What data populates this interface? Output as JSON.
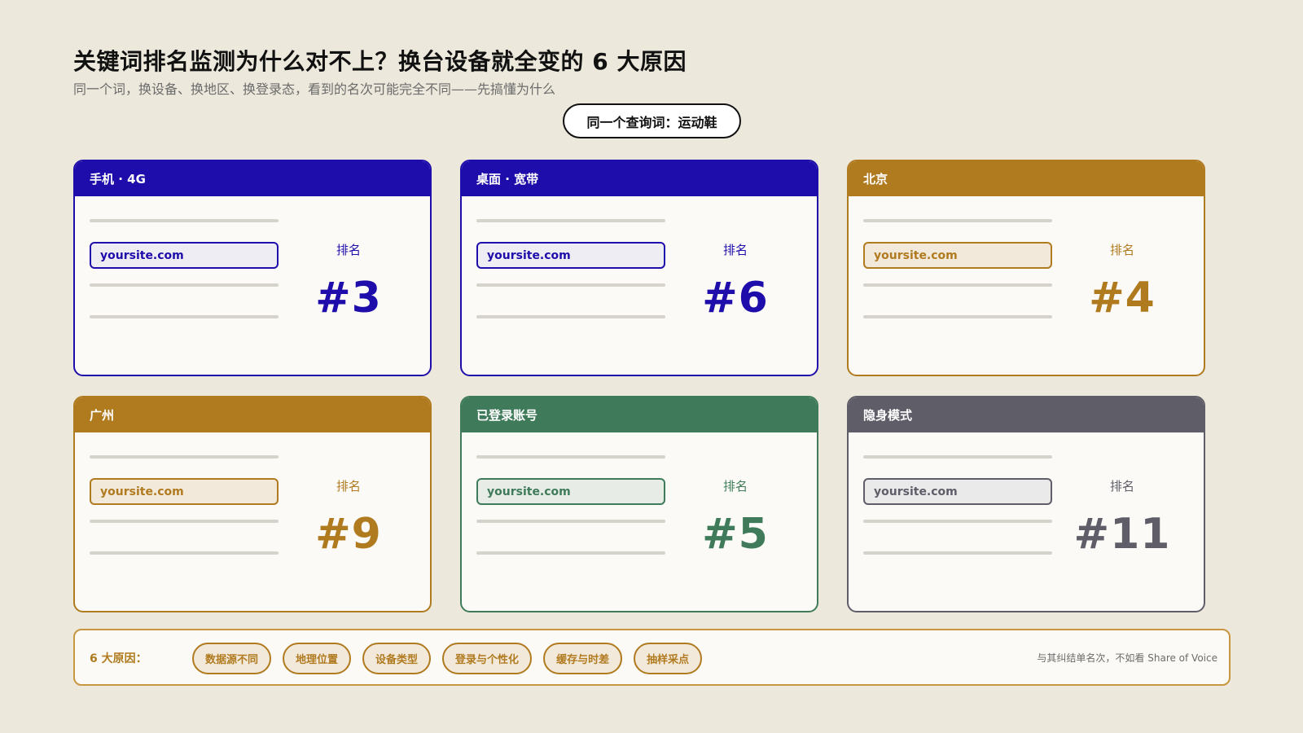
{
  "header": {
    "title": "关键词排名监测为什么对不上？换台设备就全变的 6 大原因",
    "subtitle": "同一个词，换设备、换地区、换登录态，看到的名次可能完全不同——先搞懂为什么",
    "query": "同一个查询词：运动鞋"
  },
  "cards": [
    {
      "label": "手机 · 4G",
      "site": "yoursite.com",
      "rank_label": "排名",
      "rank": "#3",
      "color": "#1E0DAA"
    },
    {
      "label": "桌面 · 宽带",
      "site": "yoursite.com",
      "rank_label": "排名",
      "rank": "#6",
      "color": "#1E0DAA"
    },
    {
      "label": "北京",
      "site": "yoursite.com",
      "rank_label": "排名",
      "rank": "#4",
      "color": "#B07A1F"
    },
    {
      "label": "广州",
      "site": "yoursite.com",
      "rank_label": "排名",
      "rank": "#9",
      "color": "#B07A1F"
    },
    {
      "label": "已登录账号",
      "site": "yoursite.com",
      "rank_label": "排名",
      "rank": "#5",
      "color": "#3F7B5A"
    },
    {
      "label": "隐身模式",
      "site": "yoursite.com",
      "rank_label": "排名",
      "rank": "#11",
      "color": "#5F5D68"
    }
  ],
  "footer": {
    "label": "6 大原因：",
    "reasons": [
      "数据源不同",
      "地理位置",
      "设备类型",
      "登录与个性化",
      "缓存与时差",
      "抽样采点"
    ],
    "note": "与其纠结单名次，不如看 Share of Voice"
  }
}
